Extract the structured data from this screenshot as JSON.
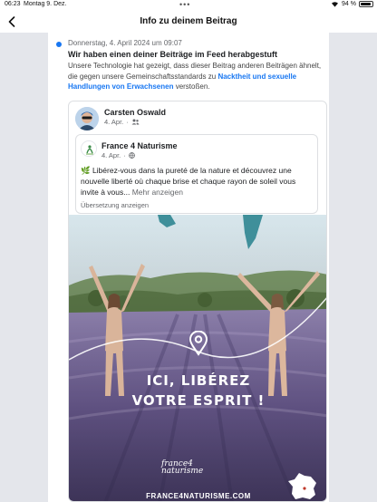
{
  "status_bar": {
    "time": "06:23",
    "date": "Montag 9. Dez.",
    "battery": "94 %",
    "battery_level": 0.94
  },
  "nav": {
    "title": "Info zu deinem Beitrag"
  },
  "notice": {
    "date": "Donnerstag, 4. April 2024 um 09:07",
    "title": "Wir haben einen deiner Beiträge im Feed herabgestuft",
    "body_prefix": "Unsere Technologie hat gezeigt, dass dieser Beitrag anderen Beiträgen ähnelt, die gegen unsere Gemeinschaftsstandards zu ",
    "body_link": "Nacktheit und sexuelle Handlungen von Erwachsenen",
    "body_suffix": " verstoßen.",
    "accent_color": "#1877f2"
  },
  "post": {
    "author": "Carsten Oswald",
    "date": "4. Apr.",
    "audience_icon": "friends-icon",
    "shared": {
      "page_name": "France 4 Naturisme",
      "date": "4. Apr.",
      "audience_icon": "globe-icon",
      "text": "🌿 Libérez-vous dans la pureté de la nature et découvrez une nouvelle liberté où chaque brise et chaque rayon de soleil vous invite à vous...",
      "more_label": "Mehr anzeigen",
      "translate_label": "Übersetzung anzeigen"
    },
    "photo": {
      "headline_line1": "ICI, LIBÉREZ",
      "headline_line2": "VOTRE ESPRIT !",
      "logo_line1": "france4",
      "logo_line2": "naturisme",
      "brand_url": "FRANCE4NATURISME.COM"
    }
  }
}
